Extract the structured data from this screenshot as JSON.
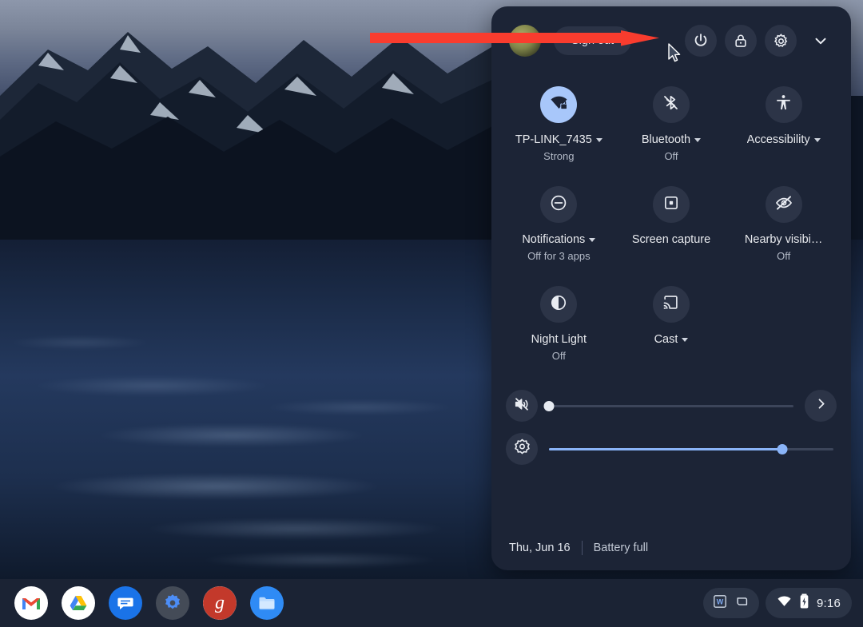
{
  "desktop": {
    "wallpaper_name": "mountain-lake-dusk"
  },
  "quick_settings": {
    "header": {
      "avatar_name": "user-avatar",
      "sign_out_label": "Sign out",
      "power_icon": "power-icon",
      "lock_icon": "lock-icon",
      "settings_icon": "gear-icon",
      "collapse_icon": "chevron-down-icon"
    },
    "tiles": [
      {
        "name": "network",
        "icon": "wifi-locked-icon",
        "label": "TP-LINK_7435",
        "sub": "Strong",
        "has_caret": true,
        "active": true
      },
      {
        "name": "bluetooth",
        "icon": "bluetooth-off-icon",
        "label": "Bluetooth",
        "sub": "Off",
        "has_caret": true,
        "active": false
      },
      {
        "name": "accessibility",
        "icon": "accessibility-icon",
        "label": "Accessibility",
        "sub": "",
        "has_caret": true,
        "active": false
      },
      {
        "name": "notifications",
        "icon": "do-not-disturb-icon",
        "label": "Notifications",
        "sub": "Off for 3 apps",
        "has_caret": true,
        "active": false
      },
      {
        "name": "screen-capture",
        "icon": "screen-capture-icon",
        "label": "Screen capture",
        "sub": "",
        "has_caret": false,
        "active": false
      },
      {
        "name": "nearby-visibility",
        "icon": "eye-off-icon",
        "label": "Nearby visibi…",
        "sub": "Off",
        "has_caret": false,
        "active": false
      },
      {
        "name": "night-light",
        "icon": "night-light-icon",
        "label": "Night Light",
        "sub": "Off",
        "has_caret": false,
        "active": false
      },
      {
        "name": "cast",
        "icon": "cast-icon",
        "label": "Cast",
        "sub": "",
        "has_caret": true,
        "active": false
      }
    ],
    "sliders": {
      "volume": {
        "icon": "volume-muted-icon",
        "value": 0,
        "muted": true,
        "expand_icon": "chevron-right-icon"
      },
      "brightness": {
        "icon": "brightness-icon",
        "value": 82,
        "muted": false
      }
    },
    "footer": {
      "date": "Thu, Jun 16",
      "battery": "Battery full"
    }
  },
  "annotation": {
    "type": "arrow",
    "color": "#f93c2e",
    "points_to": "power-icon"
  },
  "shelf": {
    "apps": [
      {
        "name": "gmail",
        "label": "Gmail"
      },
      {
        "name": "google-drive",
        "label": "Google Drive"
      },
      {
        "name": "messages",
        "label": "Messages"
      },
      {
        "name": "settings",
        "label": "Settings"
      },
      {
        "name": "groovypost",
        "label": "groovyPost"
      },
      {
        "name": "files",
        "label": "Files"
      }
    ],
    "tray": {
      "doc_icon": "word-doc-icon",
      "tote_icon": "tote-icon",
      "wifi_icon": "wifi-icon",
      "battery_icon": "battery-icon",
      "time": "9:16"
    }
  }
}
